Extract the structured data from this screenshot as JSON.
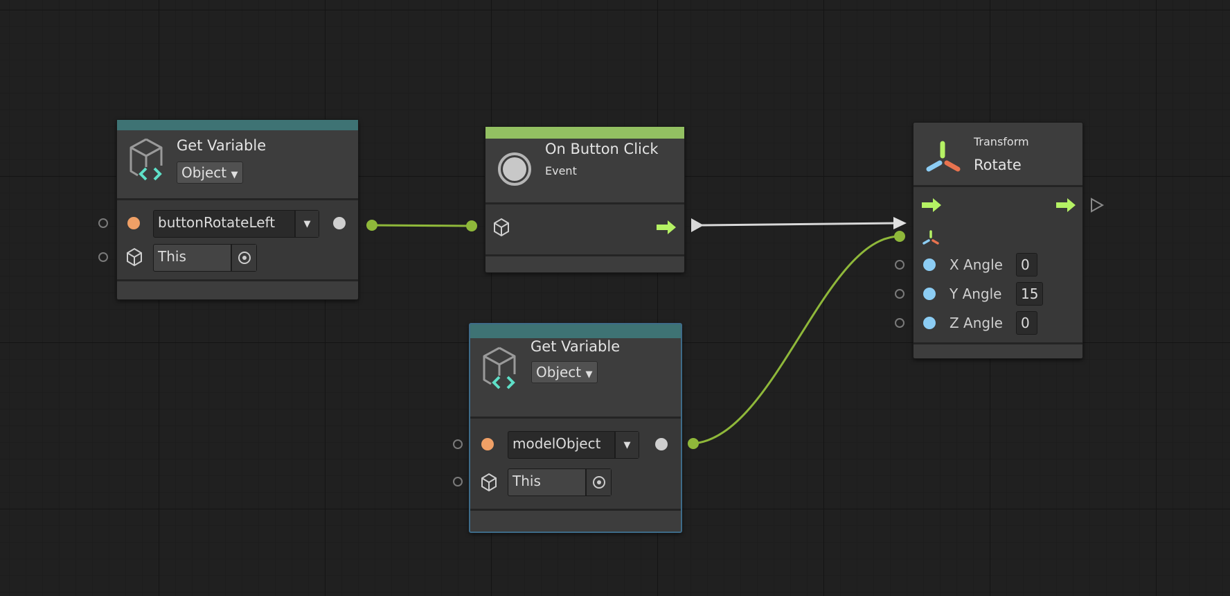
{
  "nodes": {
    "get_var_1": {
      "title": "Get Variable",
      "kind": "Object",
      "variable": "buttonRotateLeft",
      "target": "This"
    },
    "on_button_click": {
      "title": "On Button Click",
      "subtitle": "Event"
    },
    "get_var_2": {
      "title": "Get Variable",
      "kind": "Object",
      "variable": "modelObject",
      "target": "This"
    },
    "rotate": {
      "category": "Transform",
      "title": "Rotate",
      "inputs": [
        {
          "label": "X Angle",
          "value": "0"
        },
        {
          "label": "Y Angle",
          "value": "15"
        },
        {
          "label": "Z Angle",
          "value": "0"
        }
      ]
    }
  },
  "colors": {
    "variable_header": "#3e7374",
    "event_header": "#93c062",
    "wire_object": "#8fb83a",
    "wire_flow": "#d8d8d8",
    "flow_arrow": "#b5f264",
    "selected_border": "#3e6b88",
    "float_port": "#8ccdf4",
    "string_port": "#f0a066"
  }
}
